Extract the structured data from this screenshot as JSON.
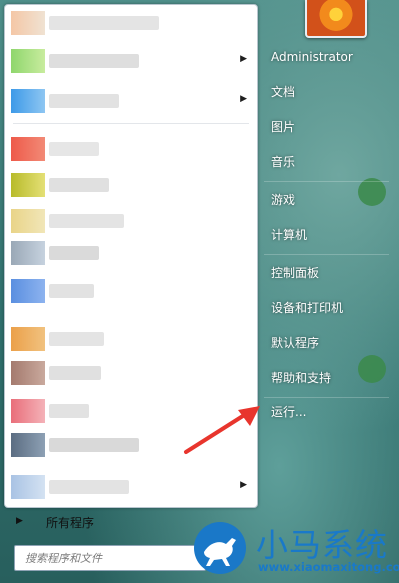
{
  "start_menu": {
    "all_programs_label": "所有程序",
    "search_placeholder": "搜索程序和文件",
    "right_items": [
      {
        "label": "Administrator"
      },
      {
        "label": "文档"
      },
      {
        "label": "图片"
      },
      {
        "label": "音乐"
      },
      {
        "label": "游戏"
      },
      {
        "label": "计算机"
      },
      {
        "label": "控制面板"
      },
      {
        "label": "设备和打印机"
      },
      {
        "label": "默认程序"
      },
      {
        "label": "帮助和支持"
      },
      {
        "label": "运行..."
      }
    ],
    "pinned_programs_blurred": true
  },
  "watermark": {
    "title": "小马系统",
    "url": "www.xiaomaxitong.com"
  },
  "colors": {
    "annotation_arrow": "#e8352d",
    "watermark_blue": "#1979c9"
  },
  "icons": [
    "user-picture",
    "submenu-arrow-icon",
    "all-programs-arrow-icon",
    "horse-logo-icon",
    "annotation-arrow"
  ]
}
